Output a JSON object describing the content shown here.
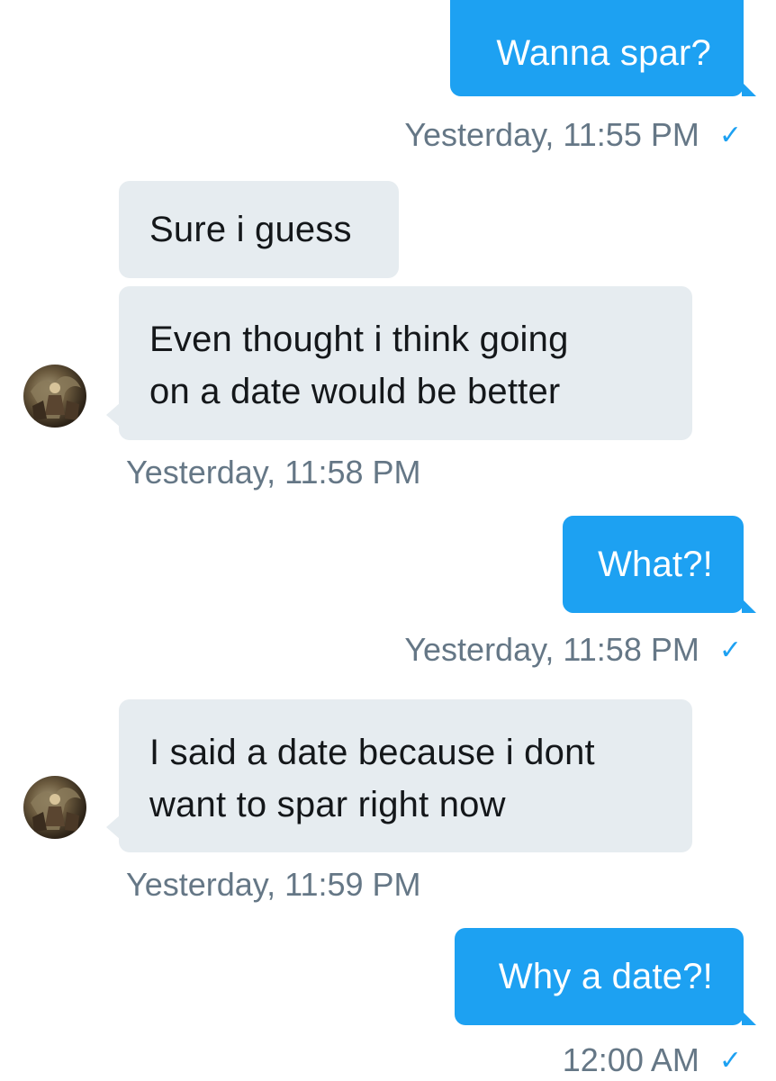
{
  "colors": {
    "outgoing_bubble": "#1da1f2",
    "incoming_bubble": "#e6ecf0",
    "timestamp": "#657786",
    "read_check": "#1da1f2"
  },
  "messages": [
    {
      "direction": "outgoing",
      "text": "Wanna spar?"
    },
    {
      "timestamp": "Yesterday, 11:55 PM",
      "read": true
    },
    {
      "direction": "incoming",
      "text": "Sure i guess"
    },
    {
      "direction": "incoming",
      "lines": [
        "Even thought i think going",
        "on a date would be better"
      ]
    },
    {
      "timestamp": "Yesterday, 11:58 PM"
    },
    {
      "direction": "outgoing",
      "text": "What?!"
    },
    {
      "timestamp": "Yesterday, 11:58 PM",
      "read": true
    },
    {
      "direction": "incoming",
      "lines": [
        "I said a date because i dont",
        "want to spar right now"
      ]
    },
    {
      "timestamp": "Yesterday, 11:59 PM"
    },
    {
      "direction": "outgoing",
      "text": "Why a date?!"
    },
    {
      "timestamp": "12:00 AM",
      "read": true
    }
  ],
  "read_check_icon": "checkmark-icon",
  "read_check_glyph": "✓",
  "avatar_icon": "contact-avatar"
}
